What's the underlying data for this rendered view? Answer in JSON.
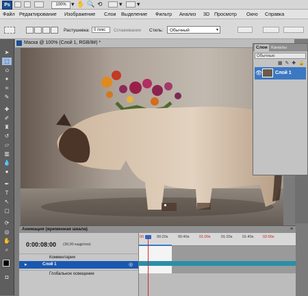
{
  "appbar": {
    "logo": "Ps",
    "zoom": "100%"
  },
  "menu": [
    "Файл",
    "Редактирование",
    "Изображение",
    "Слои",
    "Выделение",
    "Фильтр",
    "Анализ",
    "3D",
    "Просмотр",
    "Окно",
    "Справка"
  ],
  "options": {
    "feather_label": "Растушевка:",
    "feather_value": "0 пикс",
    "antialias": "Сглаживание",
    "style_label": "Стиль:",
    "style_value": "Обычный"
  },
  "document": {
    "title": "Маска @ 100% (Слой 1, RGB/8#) *"
  },
  "layers_panel": {
    "tab_layers": "Слои",
    "tab_channels": "Каналы",
    "blend_mode": "Обычные",
    "layer_name": "Слой 1"
  },
  "animation": {
    "title": "Анимация (временная шкала)",
    "timecode": "0:00:08:00",
    "fps": "(30,00 кадр/сек)",
    "rows": [
      "Комментарии",
      "Слой 1",
      "Глобальное освещение"
    ],
    "ticks": [
      "00",
      "00:20s",
      "00:40s",
      "01:00s",
      "01:20s",
      "01:40s",
      "02:00s"
    ]
  },
  "colors": {
    "accent": "#1a57b0",
    "playhead": "#d12525",
    "layer_bar": "#2a8fa8"
  }
}
